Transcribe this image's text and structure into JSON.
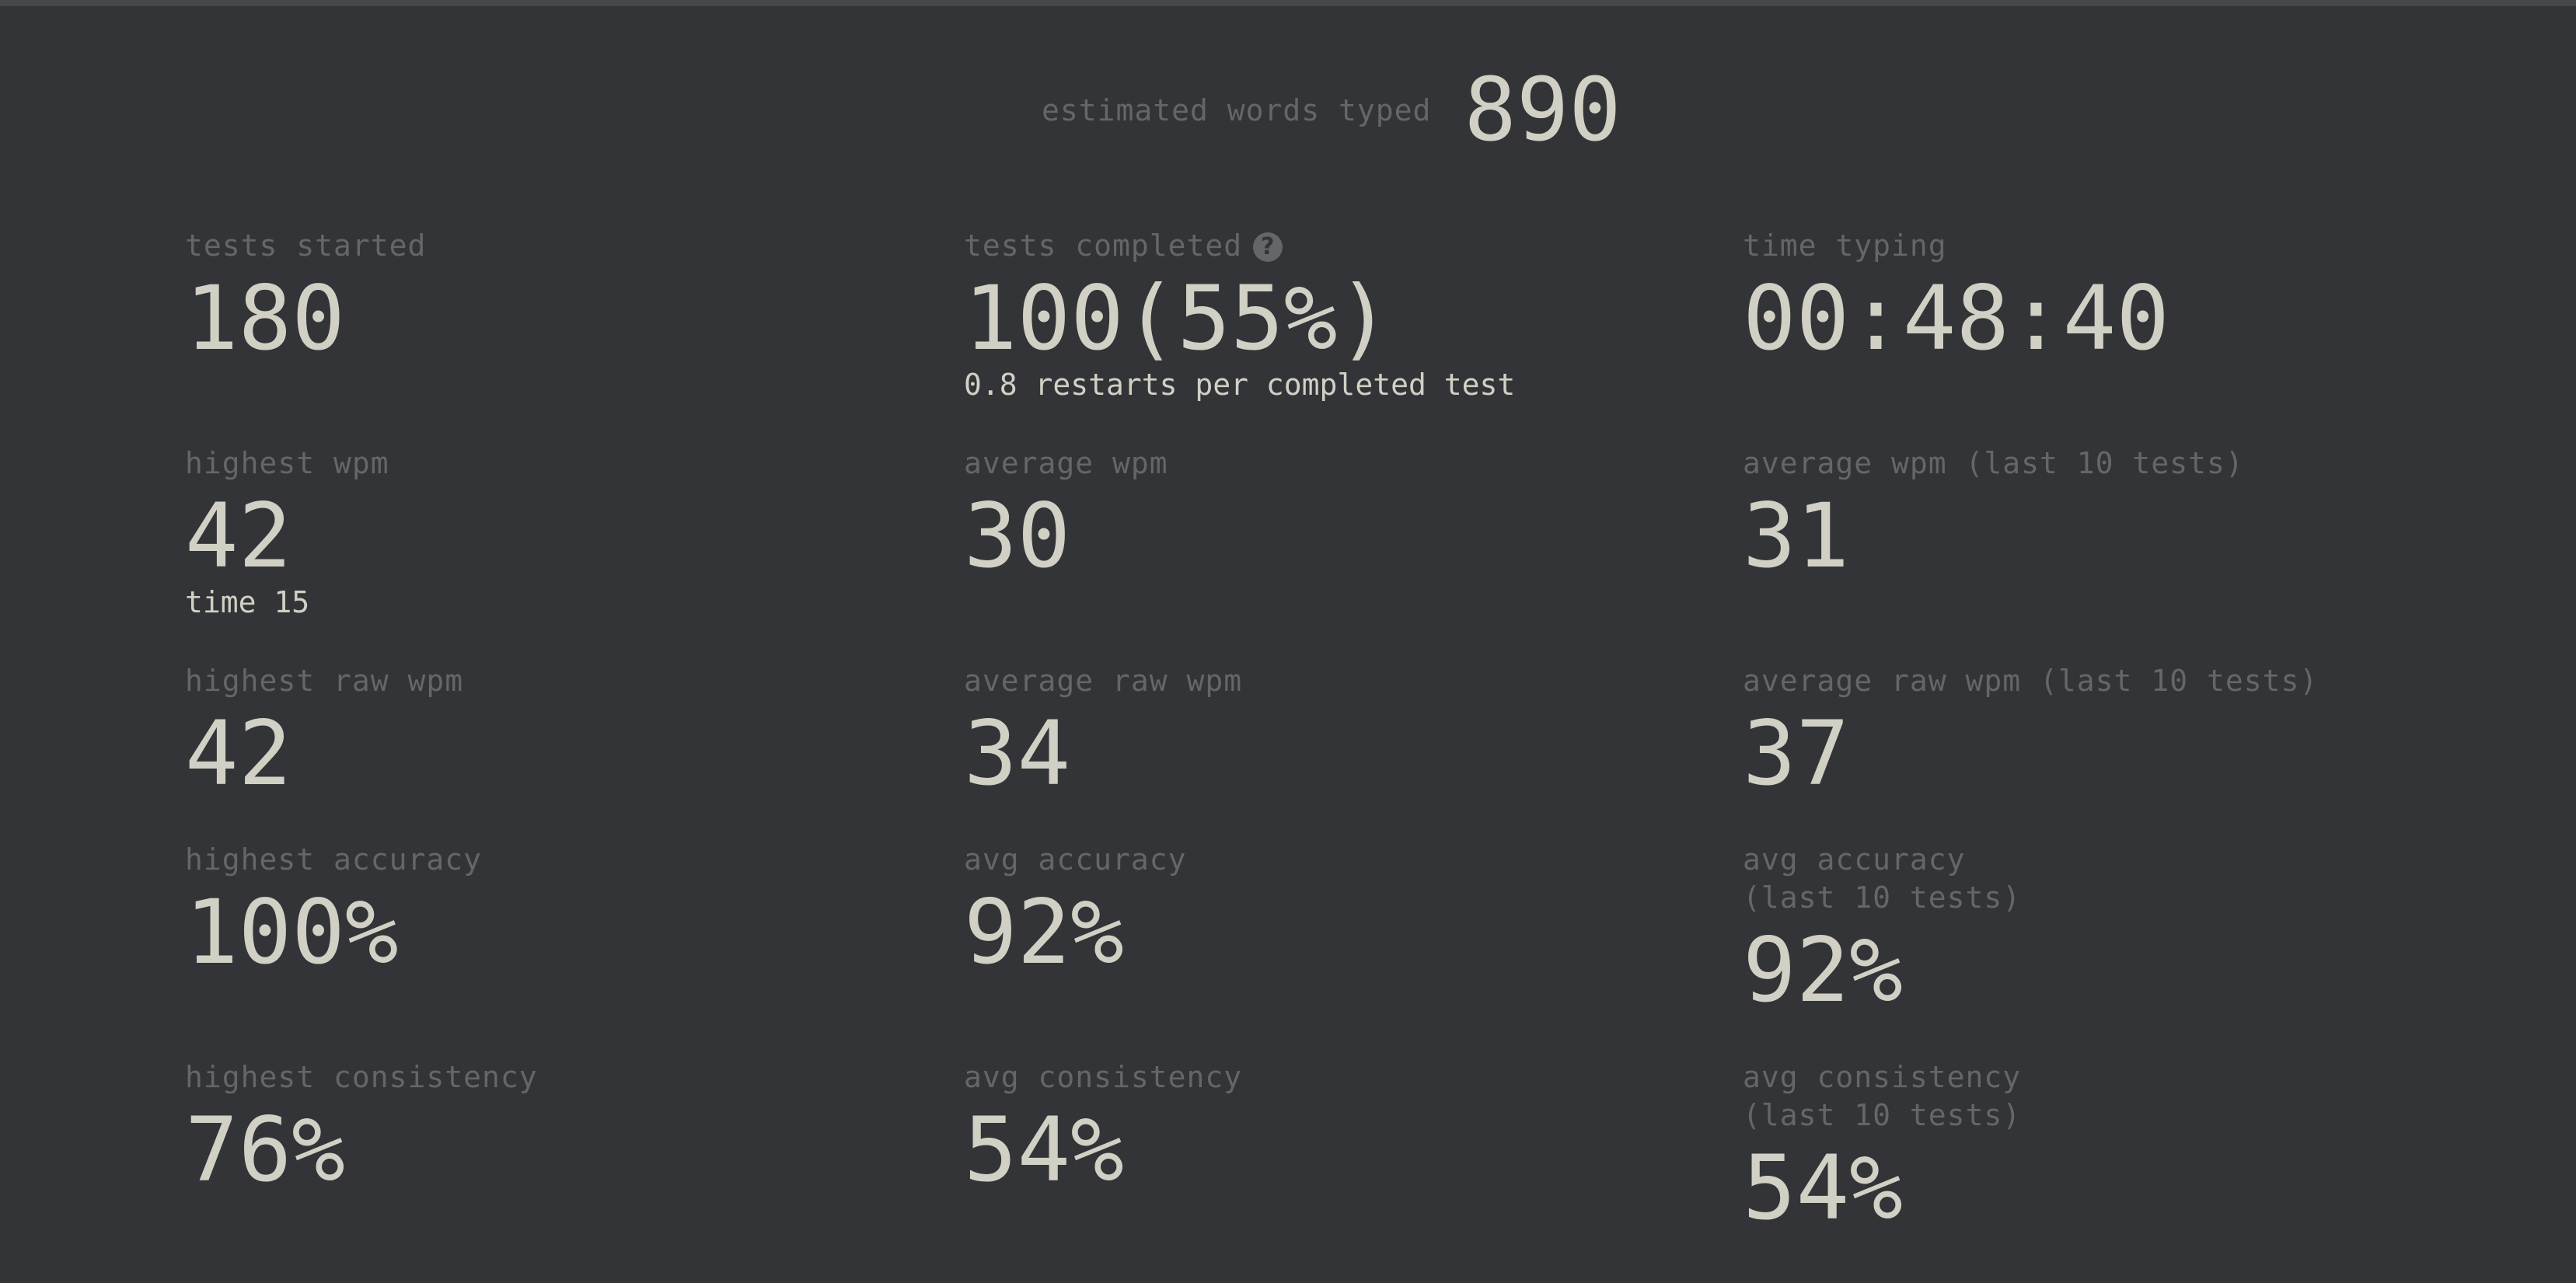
{
  "estimated": {
    "label": "estimated words typed",
    "value": "890"
  },
  "stats": {
    "tests_started": {
      "title": "tests started",
      "value": "180"
    },
    "tests_completed": {
      "title": "tests completed",
      "value": "100(55%)",
      "sub": "0.8 restarts per completed test",
      "icon": "help-circle-icon"
    },
    "time_typing": {
      "title": "time typing",
      "value": "00:48:40"
    },
    "highest_wpm": {
      "title": "highest wpm",
      "value": "42",
      "sub": "time 15"
    },
    "average_wpm": {
      "title": "average wpm",
      "value": "30"
    },
    "average_wpm_last10": {
      "title": "average wpm (last 10 tests)",
      "value": "31"
    },
    "highest_raw_wpm": {
      "title": "highest raw wpm",
      "value": "42"
    },
    "average_raw_wpm": {
      "title": "average raw wpm",
      "value": "34"
    },
    "average_raw_wpm_last10": {
      "title": "average raw wpm (last 10 tests)",
      "value": "37"
    },
    "highest_accuracy": {
      "title": "highest accuracy",
      "value": "100%"
    },
    "avg_accuracy": {
      "title": "avg accuracy",
      "value": "92%"
    },
    "avg_accuracy_last10": {
      "title_line1": "avg accuracy",
      "title_line2": "(last 10 tests)",
      "value": "92%"
    },
    "highest_consistency": {
      "title": "highest consistency",
      "value": "76%"
    },
    "avg_consistency": {
      "title": "avg consistency",
      "value": "54%"
    },
    "avg_consistency_last10": {
      "title_line1": "avg consistency",
      "title_line2": "(last 10 tests)",
      "value": "54%"
    }
  },
  "colors": {
    "background": "#323437",
    "label": "#646669",
    "value": "#d1d0c5"
  }
}
